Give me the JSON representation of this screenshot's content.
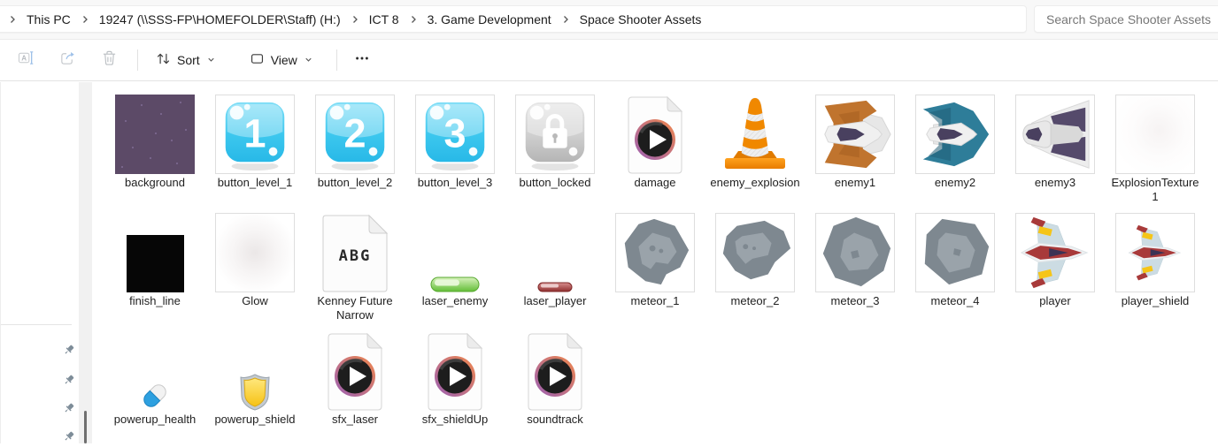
{
  "breadcrumb": {
    "items": [
      "This PC",
      "19247 (\\\\SSS-FP\\HOMEFOLDER\\Staff) (H:)",
      "ICT 8",
      "3. Game Development",
      "Space Shooter Assets"
    ]
  },
  "search": {
    "placeholder": "Search Space Shooter Assets"
  },
  "toolbar": {
    "sort_label": "Sort",
    "view_label": "View",
    "icon_buttons": [
      "rename",
      "share",
      "delete"
    ],
    "more_button": "more-options"
  },
  "palette": {
    "bg_tile_purple": "#5c4a67",
    "bg_tile_star": "#85729c",
    "button_cyan_light": "#7fdef7",
    "button_cyan_dark": "#27b8e7",
    "button_gray_light": "#e6e6e6",
    "button_gray_dark": "#b4b4b4",
    "audio_disc_dark": "#1d1d1d",
    "audio_ring_orange": "#f1874b",
    "audio_ring_purple": "#9a5fb5",
    "cone_orange": "#f08800",
    "ship_orange": "#c0742e",
    "ship_teal": "#2e7d99",
    "cockpit_purple": "#49405f",
    "meteor_gray": "#7e8890",
    "meteor_light": "#9aa3aa",
    "laser_green": "#62bd37",
    "laser_red": "#a23c3c",
    "player_red": "#a83a3a",
    "player_wing_blue": "#ccdce3",
    "accent_yellow": "#f5c518",
    "shield_gold": "#f6c214",
    "health_blue": "#2da0e0"
  },
  "files": [
    {
      "name": "background",
      "art": "bg_texture"
    },
    {
      "name": "button_level_1",
      "art": "button_cyan",
      "glyph": "1"
    },
    {
      "name": "button_level_2",
      "art": "button_cyan",
      "glyph": "2"
    },
    {
      "name": "button_level_3",
      "art": "button_cyan",
      "glyph": "3"
    },
    {
      "name": "button_locked",
      "art": "button_lock"
    },
    {
      "name": "damage",
      "art": "audio_file"
    },
    {
      "name": "enemy_explosion",
      "art": "vlc_cone"
    },
    {
      "name": "enemy1",
      "art": "ship_enemy1"
    },
    {
      "name": "enemy2",
      "art": "ship_enemy2"
    },
    {
      "name": "enemy3",
      "art": "ship_enemy3"
    },
    {
      "name": "ExplosionTexture1",
      "art": "faint_texture"
    },
    {
      "name": "finish_line",
      "art": "black_square"
    },
    {
      "name": "Glow",
      "art": "glow"
    },
    {
      "name": "Kenney Future Narrow",
      "art": "font_file",
      "glyph": "ABG"
    },
    {
      "name": "laser_enemy",
      "art": "laser_green"
    },
    {
      "name": "laser_player",
      "art": "laser_red"
    },
    {
      "name": "meteor_1",
      "art": "meteor1"
    },
    {
      "name": "meteor_2",
      "art": "meteor2"
    },
    {
      "name": "meteor_3",
      "art": "meteor3"
    },
    {
      "name": "meteor_4",
      "art": "meteor4"
    },
    {
      "name": "player",
      "art": "ship_player"
    },
    {
      "name": "player_shield",
      "art": "ship_player_small"
    },
    {
      "name": "powerup_health",
      "art": "capsule"
    },
    {
      "name": "powerup_shield",
      "art": "shield"
    },
    {
      "name": "sfx_laser",
      "art": "audio_file"
    },
    {
      "name": "sfx_shieldUp",
      "art": "audio_file"
    },
    {
      "name": "soundtrack",
      "art": "audio_file"
    }
  ]
}
